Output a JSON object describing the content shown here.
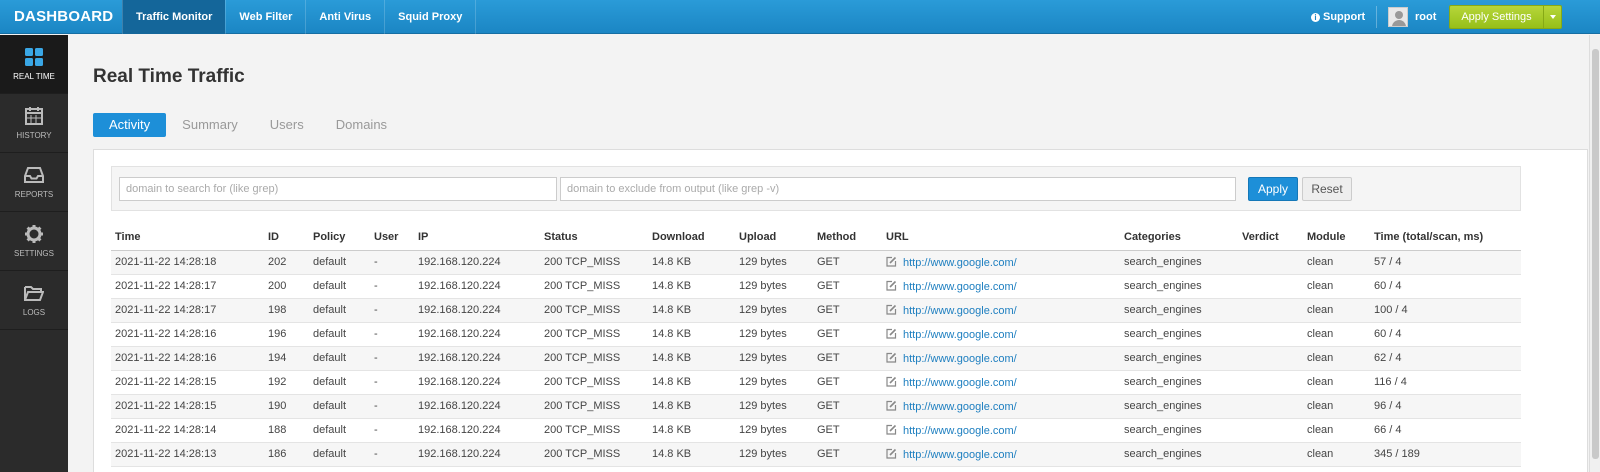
{
  "topbar": {
    "brand": "DASHBOARD",
    "nav": [
      "Traffic Monitor",
      "Web Filter",
      "Anti Virus",
      "Squid Proxy"
    ],
    "support": "Support",
    "user": "root",
    "apply_settings": "Apply Settings"
  },
  "sidebar": {
    "items": [
      {
        "label": "REAL TIME",
        "icon": "grid-icon"
      },
      {
        "label": "HISTORY",
        "icon": "calendar-icon"
      },
      {
        "label": "REPORTS",
        "icon": "inbox-icon"
      },
      {
        "label": "SETTINGS",
        "icon": "gear-icon"
      },
      {
        "label": "LOGS",
        "icon": "folder-icon"
      }
    ]
  },
  "page": {
    "title": "Real Time Traffic",
    "tabs": [
      "Activity",
      "Summary",
      "Users",
      "Domains"
    ]
  },
  "filter": {
    "search_placeholder": "domain to search for (like grep)",
    "exclude_placeholder": "domain to exclude from output (like grep -v)",
    "apply": "Apply",
    "reset": "Reset"
  },
  "table": {
    "headers": [
      "Time",
      "ID",
      "Policy",
      "User",
      "IP",
      "Status",
      "Download",
      "Upload",
      "Method",
      "URL",
      "Categories",
      "Verdict",
      "Module",
      "Time (total/scan, ms)"
    ],
    "rows": [
      [
        "2021-11-22 14:28:18",
        "202",
        "default",
        "-",
        "192.168.120.224",
        "200 TCP_MISS",
        "14.8 KB",
        "129 bytes",
        "GET",
        "http://www.google.com/",
        "search_engines",
        "",
        "clean",
        "57 / 4"
      ],
      [
        "2021-11-22 14:28:17",
        "200",
        "default",
        "-",
        "192.168.120.224",
        "200 TCP_MISS",
        "14.8 KB",
        "129 bytes",
        "GET",
        "http://www.google.com/",
        "search_engines",
        "",
        "clean",
        "60 / 4"
      ],
      [
        "2021-11-22 14:28:17",
        "198",
        "default",
        "-",
        "192.168.120.224",
        "200 TCP_MISS",
        "14.8 KB",
        "129 bytes",
        "GET",
        "http://www.google.com/",
        "search_engines",
        "",
        "clean",
        "100 / 4"
      ],
      [
        "2021-11-22 14:28:16",
        "196",
        "default",
        "-",
        "192.168.120.224",
        "200 TCP_MISS",
        "14.8 KB",
        "129 bytes",
        "GET",
        "http://www.google.com/",
        "search_engines",
        "",
        "clean",
        "60 / 4"
      ],
      [
        "2021-11-22 14:28:16",
        "194",
        "default",
        "-",
        "192.168.120.224",
        "200 TCP_MISS",
        "14.8 KB",
        "129 bytes",
        "GET",
        "http://www.google.com/",
        "search_engines",
        "",
        "clean",
        "62 / 4"
      ],
      [
        "2021-11-22 14:28:15",
        "192",
        "default",
        "-",
        "192.168.120.224",
        "200 TCP_MISS",
        "14.8 KB",
        "129 bytes",
        "GET",
        "http://www.google.com/",
        "search_engines",
        "",
        "clean",
        "116 / 4"
      ],
      [
        "2021-11-22 14:28:15",
        "190",
        "default",
        "-",
        "192.168.120.224",
        "200 TCP_MISS",
        "14.8 KB",
        "129 bytes",
        "GET",
        "http://www.google.com/",
        "search_engines",
        "",
        "clean",
        "96 / 4"
      ],
      [
        "2021-11-22 14:28:14",
        "188",
        "default",
        "-",
        "192.168.120.224",
        "200 TCP_MISS",
        "14.8 KB",
        "129 bytes",
        "GET",
        "http://www.google.com/",
        "search_engines",
        "",
        "clean",
        "66 / 4"
      ],
      [
        "2021-11-22 14:28:13",
        "186",
        "default",
        "-",
        "192.168.120.224",
        "200 TCP_MISS",
        "14.8 KB",
        "129 bytes",
        "GET",
        "http://www.google.com/",
        "search_engines",
        "",
        "clean",
        "345 / 189"
      ]
    ]
  },
  "colors": {
    "accent": "#1d8fd8",
    "topbar": "#1b86c4",
    "sidebar": "#2b2b2b",
    "apply_settings": "#a4c928",
    "link": "#1e7fc0"
  }
}
